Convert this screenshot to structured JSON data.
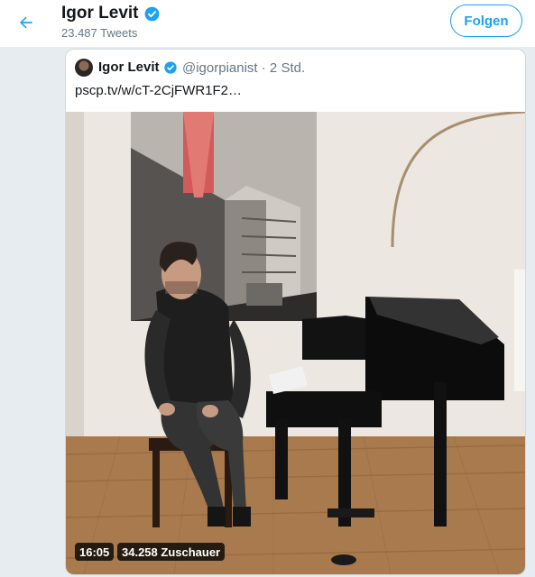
{
  "header": {
    "title": "Igor Levit",
    "tweet_count": "23.487 Tweets",
    "follow_label": "Folgen",
    "back_icon": "arrow-left-icon",
    "verified_icon": "verified-badge-icon"
  },
  "quoted_tweet": {
    "name": "Igor Levit",
    "handle_time": "@igorpianist · 2 Std.",
    "link": "pscp.tv/w/cT-2CjFWR1F2…",
    "video": {
      "duration": "16:05",
      "viewers": "34.258 Zuschauer"
    }
  },
  "colors": {
    "accent": "#1da1f2",
    "text": "#14171a",
    "secondary": "#657786",
    "feed_background": "#e6ecf0"
  }
}
